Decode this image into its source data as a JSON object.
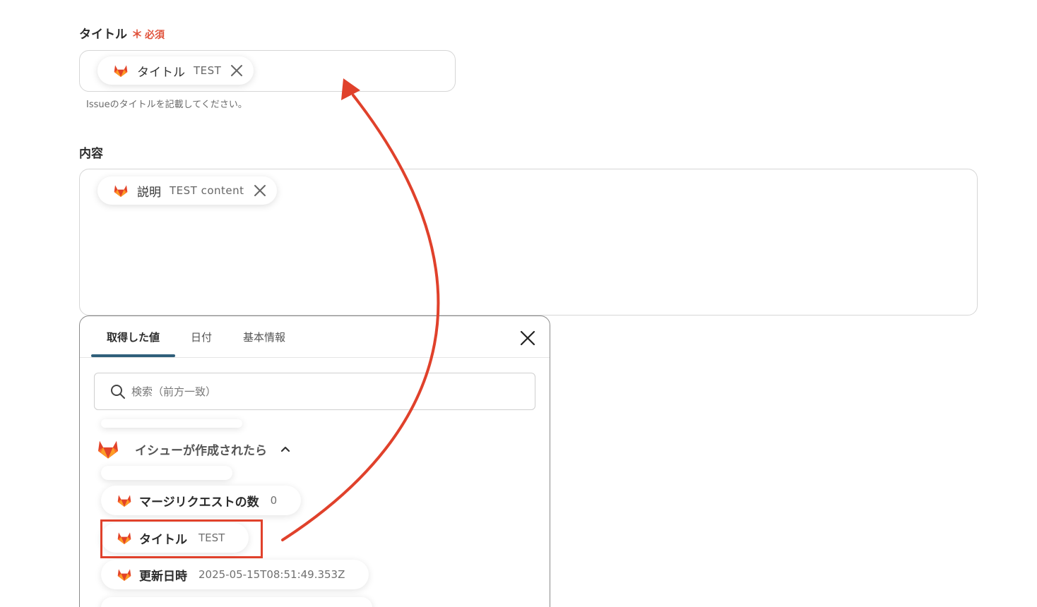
{
  "form": {
    "title_field": {
      "label": "タイトル",
      "required_mark": "＊",
      "required_text": "必須",
      "chip": {
        "label": "タイトル",
        "value": "TEST"
      },
      "hint": "Issueのタイトルを記載してください。"
    },
    "content_field": {
      "label": "内容",
      "chip": {
        "label": "説明",
        "value": "TEST content"
      }
    }
  },
  "panel": {
    "tabs": [
      {
        "label": "取得した値",
        "active": true
      },
      {
        "label": "日付",
        "active": false
      },
      {
        "label": "基本情報",
        "active": false
      }
    ],
    "search_placeholder": "検索（前方一致）",
    "group": {
      "label": "イシューが作成されたら",
      "items": [
        {
          "label": "マージリクエストの数",
          "value": "0"
        },
        {
          "label": "タイトル",
          "value": "TEST"
        },
        {
          "label": "更新日時",
          "value": "2025-05-15T08:51:49.353Z"
        }
      ]
    }
  },
  "colors": {
    "accent_red": "#e0412b",
    "tab_indicator": "#2f5f7a",
    "fox_orange": "#e24329",
    "fox_light": "#fca326"
  }
}
